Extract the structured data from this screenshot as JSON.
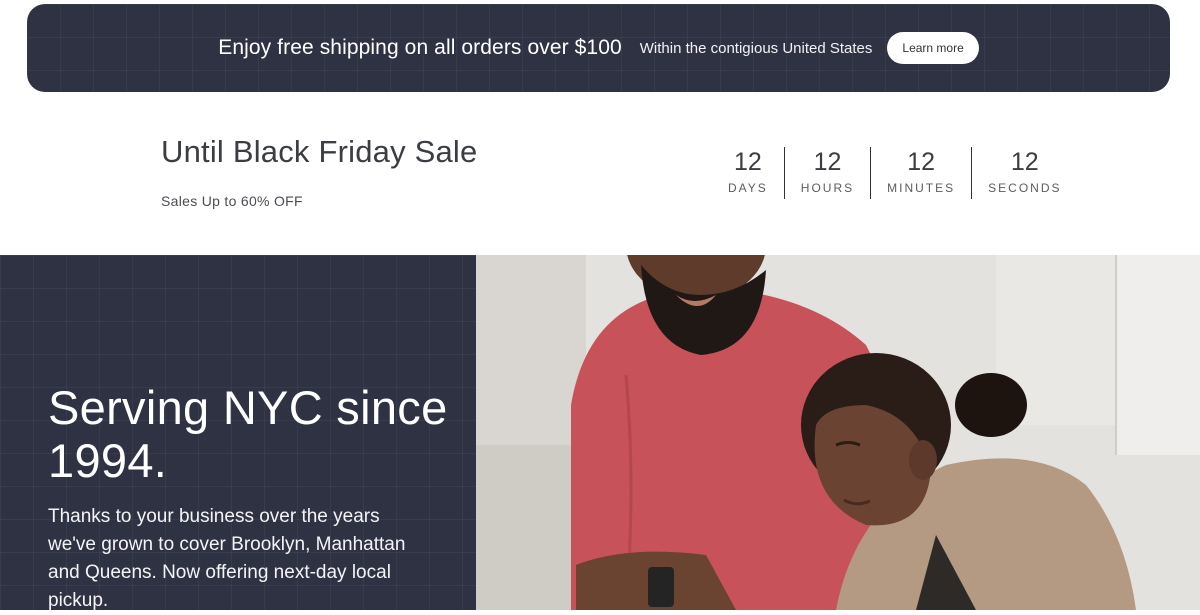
{
  "banner": {
    "headline": "Enjoy free shipping on all orders over $100",
    "subtext": "Within the contigious United States",
    "cta_label": "Learn more"
  },
  "sale": {
    "title": "Until Black Friday Sale",
    "subtitle": "Sales Up to 60% OFF"
  },
  "countdown": [
    {
      "value": "12",
      "label": "DAYS"
    },
    {
      "value": "12",
      "label": "HOURS"
    },
    {
      "value": "12",
      "label": "MINUTES"
    },
    {
      "value": "12",
      "label": "SECONDS"
    }
  ],
  "hero": {
    "title": "Serving NYC since 1994.",
    "body": "Thanks to your business over the years we've grown to cover Brooklyn, Manhattan and Queens. Now offering next-day local pickup."
  },
  "colors": {
    "navy": "#2f3242",
    "shirt_red": "#c8525a",
    "cardigan": "#b49a82"
  }
}
